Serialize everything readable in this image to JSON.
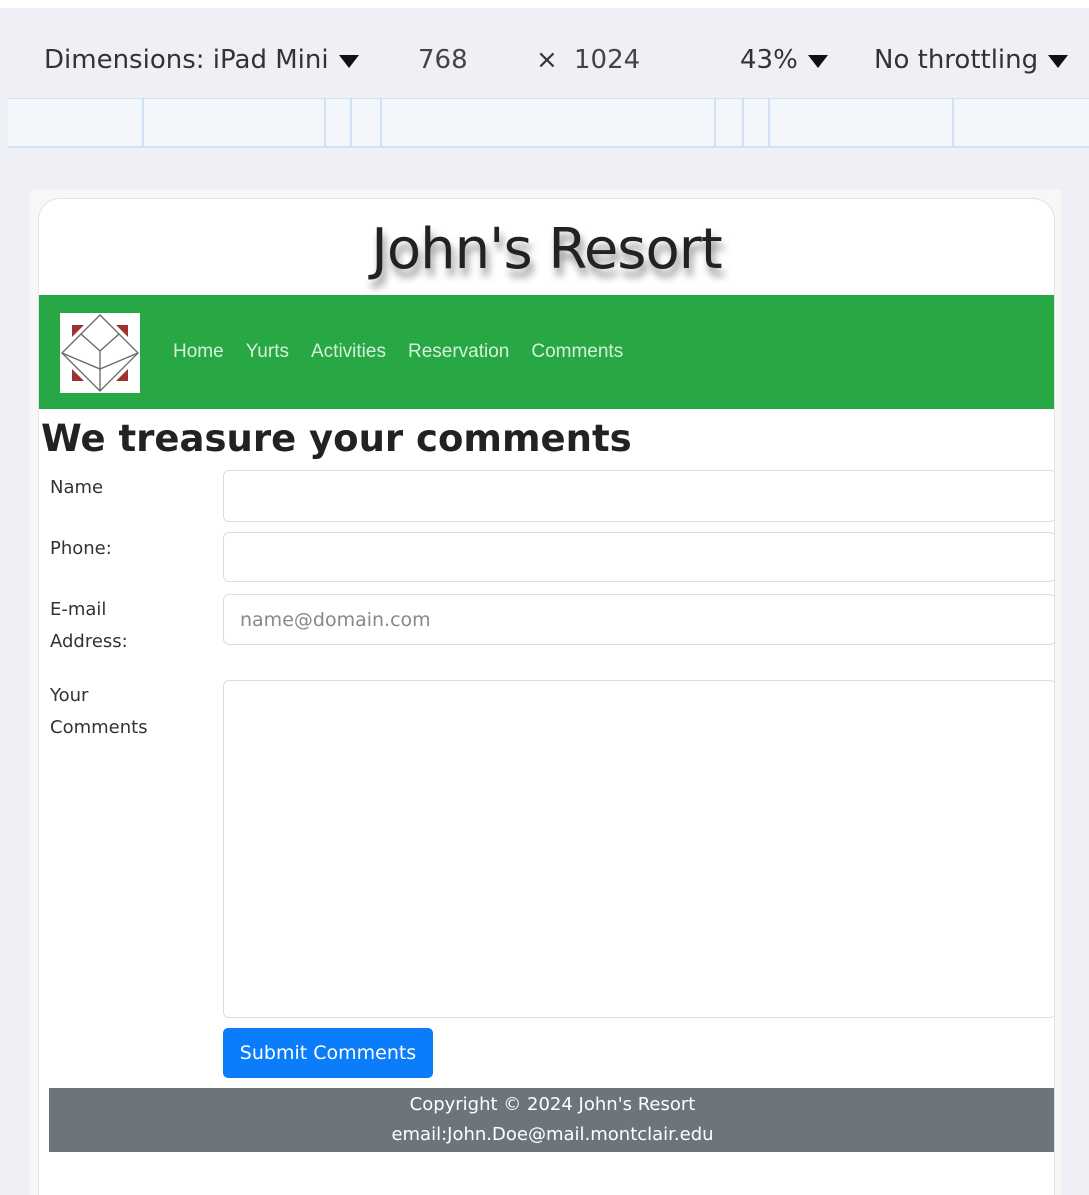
{
  "devtools": {
    "dimensions_label": "Dimensions: iPad Mini",
    "width": "768",
    "times": "×",
    "height": "1024",
    "zoom": "43%",
    "throttling": "No throttling"
  },
  "site": {
    "title": "John's Resort",
    "nav": [
      "Home",
      "Yurts",
      "Activities",
      "Reservation",
      "Comments"
    ],
    "heading": "We treasure your comments",
    "form": {
      "name_label": "Name",
      "name_value": "",
      "phone_label": "Phone:",
      "phone_value": "",
      "email_label_line1": "E-mail",
      "email_label_line2": "Address:",
      "email_placeholder": "name@domain.com",
      "comments_label_line1": "Your",
      "comments_label_line2": "Comments",
      "comments_value": "",
      "submit_label": "Submit Comments"
    },
    "footer": {
      "copyright": "Copyright © 2024 John's Resort",
      "email": "email:John.Doe@mail.montclair.edu"
    }
  },
  "colors": {
    "navbar": "#28a745",
    "submit": "#0b7dfb",
    "footer": "#6d747c",
    "logo_accent": "#a0322e"
  },
  "icons": {
    "logo": "cube-logo-icon",
    "dropdown": "caret-down-icon"
  }
}
